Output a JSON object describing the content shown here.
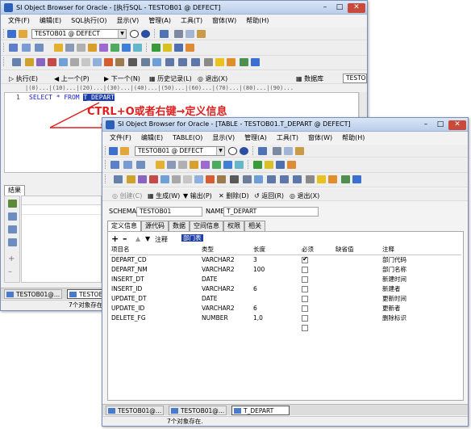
{
  "annotation": "CTRL+O或者右键→定义信息",
  "back_window": {
    "title": "SI Object Browser for Oracle - [执行SQL - TESTOB01 @ DEFECT]",
    "menu": [
      "文件(F)",
      "编辑(E)",
      "SQL执行(O)",
      "显示(V)",
      "管理(A)",
      "工具(T)",
      "窗体(W)",
      "帮助(H)"
    ],
    "connection": "TESTOB01 @ DEFECT",
    "exec_toolbar": [
      "执行(E)",
      "上一个(P)",
      "下一个(N)",
      "历史记录(L)",
      "退出(X)",
      "数据库"
    ],
    "exec_right_label": "TESTO",
    "ruler": "|(0)...|(10)...|(20)...|(30)...|(40)...|(50)...|(60)...|(70)...|(80)...|(90)...",
    "editor": {
      "line_no": "1",
      "sql_prefix": "SELECT * FROM ",
      "sql_selected": "T_DEPART"
    },
    "result_label": "结果",
    "taskbar": [
      "TESTOB01@…",
      "TESTOB01@…"
    ],
    "status": "7个对象存在."
  },
  "front_window": {
    "title": "SI Object Browser for Oracle - [TABLE - TESTOB01.T_DEPART @ DEFECT]",
    "menu": [
      "文件(F)",
      "编辑(E)",
      "TABLE(O)",
      "显示(V)",
      "管理(A)",
      "工具(T)",
      "窗体(W)",
      "帮助(H)"
    ],
    "connection": "TESTOB01 @ DEFECT",
    "action_toolbar": [
      "创建(C)",
      "生成(W)",
      "输出(P)",
      "删除(D)",
      "返回(R)",
      "退出(X)"
    ],
    "schema_label": "SCHEMA",
    "schema_value": "TESTOB01",
    "name_label": "NAME",
    "name_value": "T_DEPART",
    "tabs": [
      "定义信息",
      "源代码",
      "数据",
      "空间信息",
      "权限",
      "相关"
    ],
    "comment_label": "注释",
    "comment_value": "部门表",
    "columns_header": [
      "项目名",
      "类型",
      "长度",
      "必须",
      "缺省值",
      "注释"
    ],
    "columns": [
      {
        "name": "DEPART_CD",
        "type": "VARCHAR2",
        "length": "3",
        "required": true,
        "default": "",
        "comment": "部门代码"
      },
      {
        "name": "DEPART_NM",
        "type": "VARCHAR2",
        "length": "100",
        "required": false,
        "default": "",
        "comment": "部门名称"
      },
      {
        "name": "INSERT_DT",
        "type": "DATE",
        "length": "",
        "required": false,
        "default": "",
        "comment": "新建时间"
      },
      {
        "name": "INSERT_ID",
        "type": "VARCHAR2",
        "length": "6",
        "required": false,
        "default": "",
        "comment": "新建者"
      },
      {
        "name": "UPDATE_DT",
        "type": "DATE",
        "length": "",
        "required": false,
        "default": "",
        "comment": "更新时间"
      },
      {
        "name": "UPDATE_ID",
        "type": "VARCHAR2",
        "length": "6",
        "required": false,
        "default": "",
        "comment": "更新者"
      },
      {
        "name": "DELETE_FG",
        "type": "NUMBER",
        "length": "1,0",
        "required": false,
        "default": "",
        "comment": "删除标识"
      }
    ],
    "taskbar": [
      "TESTOB01@…",
      "TESTOB01@…",
      "T_DEPART"
    ],
    "status": "7个对象存在."
  },
  "colors": {
    "title_gradient_top": "#d9e6f7",
    "selection": "#1f3fa8",
    "annotation": "#e02020",
    "arrow": "#e02020"
  }
}
